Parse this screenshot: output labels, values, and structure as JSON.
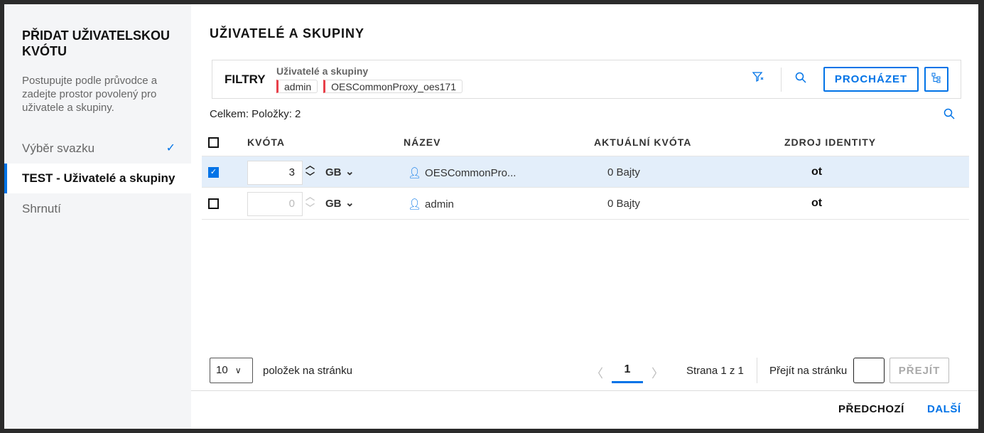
{
  "sidebar": {
    "title": "PŘIDAT UŽIVATELSKOU KVÓTU",
    "description": "Postupujte podle průvodce a zadejte prostor povolený pro uživatele a skupiny.",
    "steps": [
      {
        "label": "Výběr svazku",
        "done": true
      },
      {
        "label": "TEST - Uživatelé a skupiny",
        "active": true
      },
      {
        "label": "Shrnutí"
      }
    ]
  },
  "main": {
    "title": "UŽIVATELÉ A SKUPINY",
    "filters": {
      "label": "FILTRY",
      "group": "Uživatelé a skupiny",
      "chips": [
        "admin",
        "OESCommonProxy_oes171"
      ],
      "browse": "PROCHÁZET"
    },
    "total": "Celkem: Položky: 2",
    "columns": [
      "KVÓTA",
      "NÁZEV",
      "AKTUÁLNÍ KVÓTA",
      "ZDROJ IDENTITY"
    ],
    "rows": [
      {
        "checked": true,
        "quota": "3",
        "unit": "GB",
        "name": "OESCommonPro...",
        "current": "0 Bajty",
        "source": "ot"
      },
      {
        "checked": false,
        "quota": "0",
        "unit": "GB",
        "name": "admin",
        "current": "0 Bajty",
        "source": "ot"
      }
    ],
    "pagination": {
      "per_page": "10",
      "per_page_label": "položek na stránku",
      "page": "1",
      "info": "Strana 1 z 1",
      "goto_label": "Přejít na stránku",
      "goto_value": "",
      "goto_button": "PŘEJÍT"
    }
  },
  "footer": {
    "prev": "PŘEDCHOZÍ",
    "next": "DALŠÍ"
  },
  "colors": {
    "accent": "#0073e7",
    "chip": "#e8404a",
    "selected_row": "#e3eefa"
  }
}
